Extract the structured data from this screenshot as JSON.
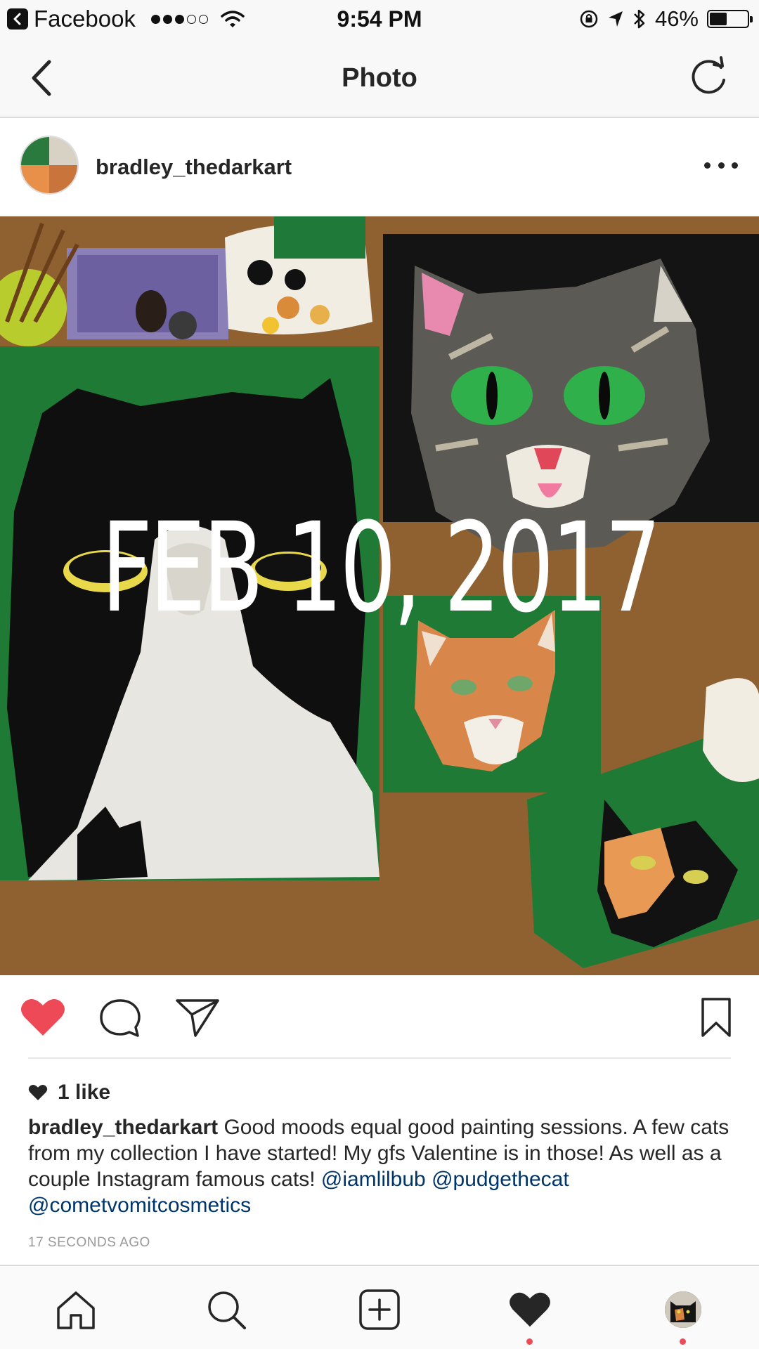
{
  "status_bar": {
    "back_app": "Facebook",
    "signal_bars_filled": 3,
    "signal_bars_total": 5,
    "time": "9:54 PM",
    "battery_percent": "46%",
    "battery_level": 0.46
  },
  "nav": {
    "title": "Photo"
  },
  "post": {
    "username": "bradley_thedarkart",
    "image_overlay_text": "FEB 10, 2017",
    "liked": true,
    "likes_text": "1 like",
    "caption": {
      "username": "bradley_thedarkart",
      "text": "Good moods equal good painting sessions. A few cats from my collection I have started! My gfs Valentine is in those! As well as a couple Instagram famous cats!",
      "mentions": [
        "@iamlilbub",
        "@pudgethecat",
        "@cometvomitcosmetics"
      ]
    },
    "timestamp": "17 SECONDS AGO"
  },
  "colors": {
    "like_red": "#ed4956",
    "mention_blue": "#003569",
    "text_dark": "#262626",
    "meta_gray": "#999999"
  },
  "icons": {
    "nav": [
      "back-chevron-icon",
      "refresh-icon"
    ],
    "post_actions": [
      "heart-filled-icon",
      "comment-icon",
      "share-icon",
      "bookmark-icon"
    ],
    "tab_bar": [
      "home-icon",
      "search-icon",
      "add-post-icon",
      "activity-heart-icon",
      "profile-avatar-icon"
    ]
  }
}
